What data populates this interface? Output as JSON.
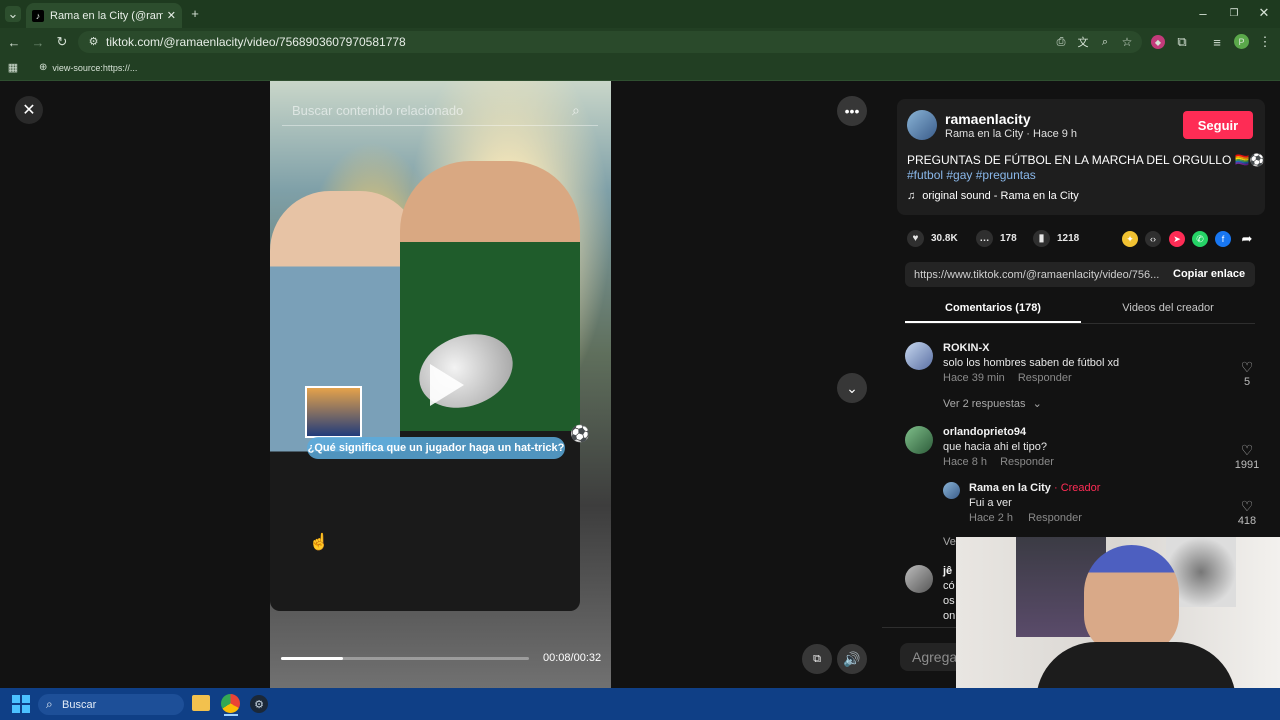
{
  "browser": {
    "tab_title": "Rama en la City (@ramaenlacity",
    "tab_favicon": "tiktok-icon",
    "url": "tiktok.com/@ramaenlacity/video/7568903607970581778",
    "bookmark": "view-source:https://...",
    "profile_initial": "P"
  },
  "video": {
    "search_placeholder": "Buscar contenido relacionado",
    "caption": "¿Qué significa que un jugador haga un hat-trick?",
    "time": "00:08/00:32",
    "progress": 0.25
  },
  "post": {
    "username": "ramaenlacity",
    "display_line": "Rama en la City · Hace 9 h",
    "follow_label": "Seguir",
    "description": "PREGUNTAS DE FÚTBOL EN LA MARCHA DEL ORGULLO 🏳️‍🌈⚽",
    "hashtags": "#futbol #gay #preguntas",
    "sound": "original sound - Rama en la City",
    "likes": "30.8K",
    "comments": "178",
    "saves": "1218",
    "link": "https://www.tiktok.com/@ramaenlacity/video/756...",
    "copy_label": "Copiar enlace",
    "accent_color": "#fe2c55"
  },
  "tabs": {
    "comments": "Comentarios (178)",
    "creator_videos": "Videos del creador"
  },
  "comments": [
    {
      "name": "ROKIN-X",
      "text": "solo los hombres saben de fútbol xd",
      "time": "Hace 39 min",
      "reply": "Responder",
      "likes": "5",
      "replies": "Ver 2 respuestas"
    },
    {
      "name": "orlandoprieto94",
      "text": "que hacia ahi el tipo?",
      "time": "Hace 8 h",
      "reply": "Responder",
      "likes": "1991"
    },
    {
      "name": "Rama en la City",
      "creator": "· Creador",
      "text": "Fui a ver",
      "time": "Hace 2 h",
      "reply": "Responder",
      "likes": "418"
    },
    {
      "name": "jê",
      "text": "có",
      "line2": "os",
      "line3": "on",
      "more": "Ve"
    }
  ],
  "add_comment": "Agrega",
  "taskbar": {
    "search": "Buscar"
  }
}
